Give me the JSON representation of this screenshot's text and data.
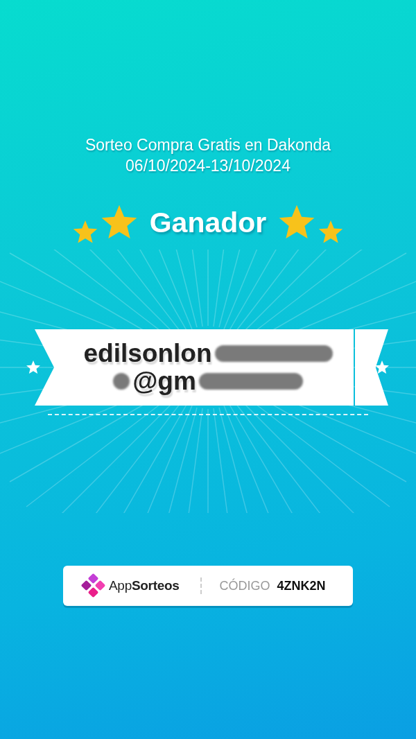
{
  "header": {
    "title": "Sorteo Compra Gratis en Dakonda",
    "dates": "06/10/2024-13/10/2024"
  },
  "winner": {
    "label": "Ganador",
    "email_lines": [
      {
        "text": "edilsonlon",
        "blurred_before": false,
        "blurred_after": true
      },
      {
        "text": "@gm",
        "blurred_before": true,
        "blurred_after": true
      }
    ]
  },
  "footer": {
    "brand": "App**Sorteos**",
    "code_label": "CÓDIGO",
    "code": "4ZNK2N"
  }
}
